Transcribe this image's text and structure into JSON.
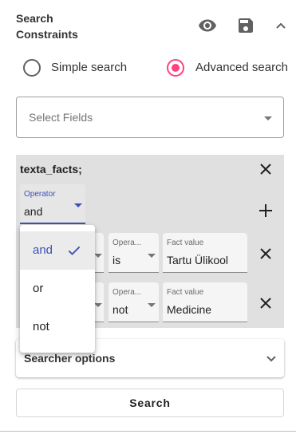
{
  "header": {
    "title": "Search Constraints",
    "icons": {
      "visibility": "eye-icon",
      "save": "save-icon",
      "collapse": "chevron-up-icon"
    }
  },
  "search_mode": {
    "options": [
      {
        "label": "Simple search",
        "selected": false
      },
      {
        "label": "Advanced search",
        "selected": true
      }
    ],
    "accent_color": "#ff4081"
  },
  "select_fields": {
    "placeholder": "Select Fields"
  },
  "constraint_panel": {
    "title": "texta_facts;",
    "operator": {
      "label": "Operator",
      "value": "and"
    },
    "rows": [
      {
        "operator_label": "Opera...",
        "operator_value": "is",
        "fact_label": "Fact value",
        "fact_value": "Tartu Ülikool"
      },
      {
        "operator_label": "Opera...",
        "operator_value": "not",
        "fact_label": "Fact value",
        "fact_value": "Medicine"
      }
    ]
  },
  "operator_dropdown": {
    "options": [
      {
        "label": "and",
        "selected": true
      },
      {
        "label": "or",
        "selected": false
      },
      {
        "label": "not",
        "selected": false
      }
    ],
    "selected_color": "#3f51b5"
  },
  "searcher_options": {
    "label": "Searcher options"
  },
  "search_button": {
    "label": "Search"
  }
}
